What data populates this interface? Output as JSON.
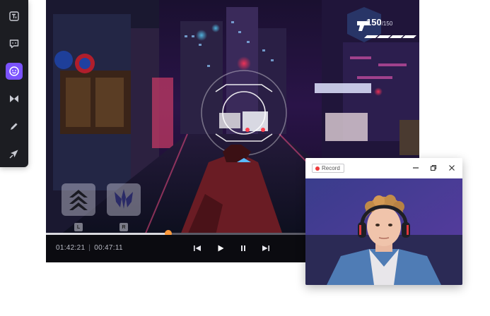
{
  "toolbar": {
    "items": [
      {
        "name": "text-tool",
        "icon": "text-box-icon",
        "active": false
      },
      {
        "name": "comment-tool",
        "icon": "speech-bubble-icon",
        "active": false
      },
      {
        "name": "sticker-tool",
        "icon": "smiley-sticker-icon",
        "active": true
      },
      {
        "name": "transition-tool",
        "icon": "bowtie-transition-icon",
        "active": false
      },
      {
        "name": "pen-tool",
        "icon": "pen-icon",
        "active": false
      },
      {
        "name": "cursor-tool",
        "icon": "cursor-click-icon",
        "active": false
      }
    ],
    "accent": "#7b53ff"
  },
  "player": {
    "hud": {
      "ammo_current": "150",
      "ammo_total": "/150",
      "weapon_icon": "pistol-icon",
      "skill_left_key": "L",
      "skill_right_key": "R"
    },
    "progress": 0.327,
    "progress_color": "#ff9a3c",
    "time_current": "01:42:21",
    "time_separator": "|",
    "time_total": "00:47:11",
    "controls": [
      "skip-back-icon",
      "play-icon",
      "pause-icon",
      "skip-forward-icon"
    ]
  },
  "record_window": {
    "badge_label": "Record",
    "badge_dot_color": "#ef3b3b",
    "buttons": [
      "minimize-icon",
      "maximize-icon",
      "close-icon"
    ]
  }
}
